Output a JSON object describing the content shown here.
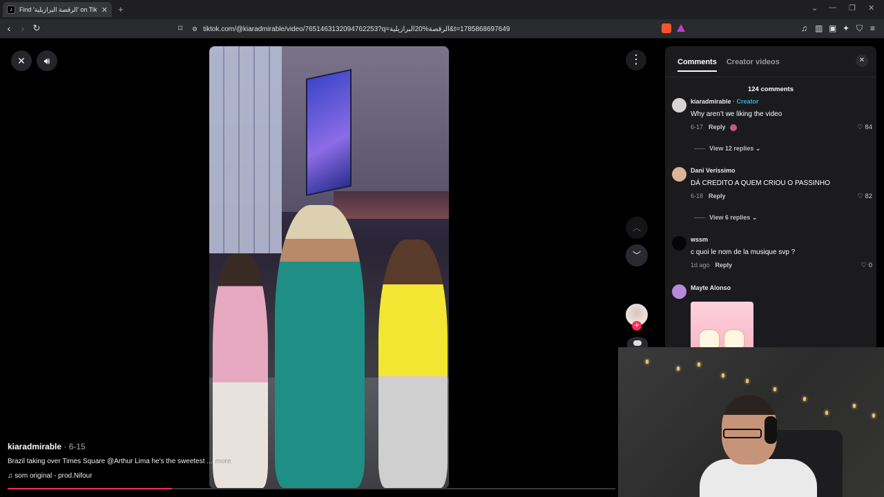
{
  "browser": {
    "tab_title": "Find 'الرقصة البرازيلية' on TikTok",
    "tab_favicon": "tiktok-icon",
    "url": "tiktok.com/@kiaradmirable/video/7651463132094762253?q=الرقصة%20البرازيلية&t=1785868697649"
  },
  "video": {
    "username": "kiaradmirable",
    "date": " · 6-15",
    "description": "Brazil taking over Times Square @Arthur Lima he's the sweetest ...",
    "more_label": "more",
    "sound": "♫  som original - prod.Nifour",
    "progress": 0.27
  },
  "panel": {
    "tabs": [
      "Comments",
      "Creator videos"
    ],
    "active_tab": "Comments",
    "comment_count": "124 comments",
    "comments": [
      {
        "user": "kiaradmirable",
        "badge": " · Creator",
        "text": "Why aren’t we liking the video",
        "date": "6-17",
        "reply_label": "Reply",
        "likes": "84",
        "replies": "View 12 replies",
        "avatar_color": "#d8d4d4"
      },
      {
        "user": "Dani Veríssimo",
        "text": "DÁ CREDITO A QUEM CRIOU O PASSINHO",
        "date": "6-18",
        "reply_label": "Reply",
        "likes": "82",
        "replies": "View 6 replies",
        "avatar_color": "#d9b39a"
      },
      {
        "user": "wssm",
        "text": "c quoi le nom de la musique svp ?",
        "date": "1d ago",
        "reply_label": "Reply",
        "likes": "0",
        "avatar_color": "#050505"
      },
      {
        "user": "Mayte Alonso",
        "avatar_color": "#b78ad9"
      }
    ]
  },
  "colors": {
    "accent": "#fe2c55",
    "creator_badge": "#25b4d3"
  }
}
